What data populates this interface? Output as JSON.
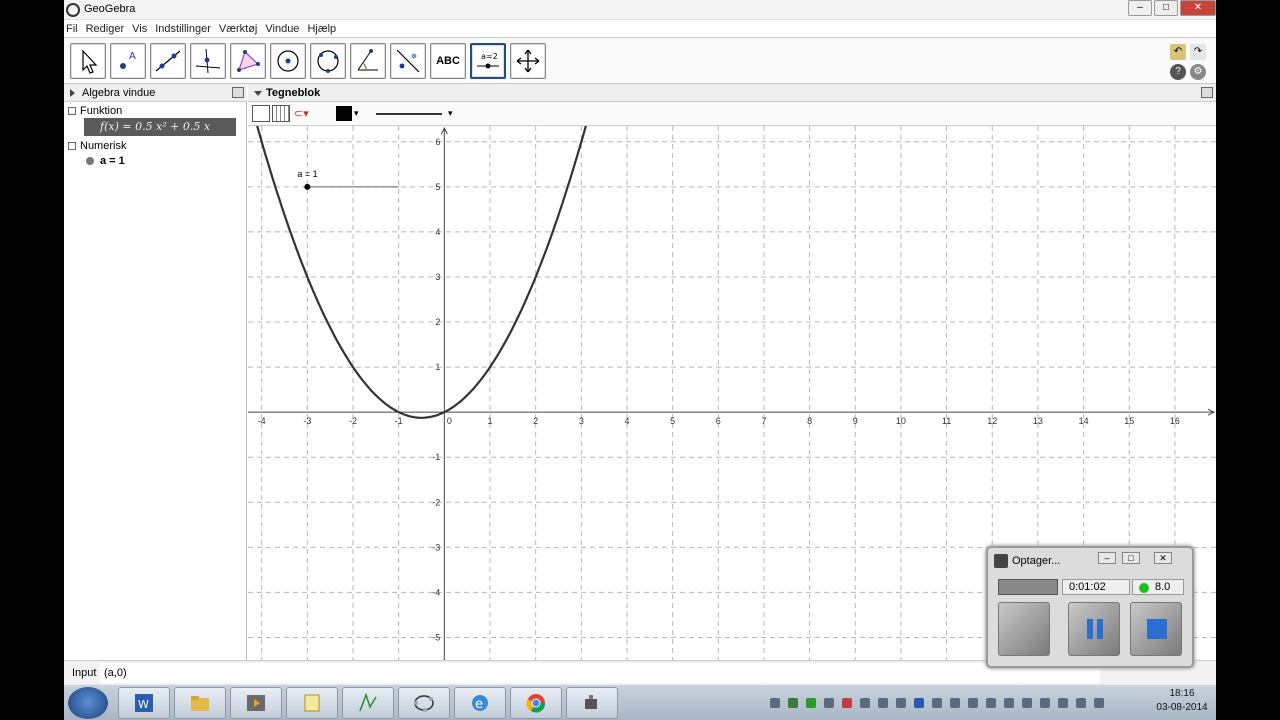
{
  "window": {
    "title": "GeoGebra"
  },
  "menu": [
    "Fil",
    "Rediger",
    "Vis",
    "Indstillinger",
    "Værktøj",
    "Vindue",
    "Hjælp"
  ],
  "toolbar": {
    "text_tool_label": "ABC",
    "slider_tool_label": "a=2"
  },
  "algebra": {
    "title": "Algebra vindue",
    "functions_label": "Funktion",
    "function_text": "f(x) = 0.5 x² + 0.5 x",
    "numeric_label": "Numerisk",
    "numeric_item": "a = 1"
  },
  "graphics": {
    "title": "Tegneblok",
    "slider_label": "a = 1"
  },
  "chart_data": {
    "type": "line",
    "x_ticks": [
      "-4",
      "-3",
      "-2",
      "-1",
      "0",
      "1",
      "2",
      "3",
      "4",
      "5",
      "6",
      "7",
      "8",
      "9",
      "10",
      "11",
      "12",
      "13",
      "14",
      "15",
      "16"
    ],
    "y_ticks": [
      "-5",
      "-4",
      "-3",
      "-2",
      "-1",
      "1",
      "2",
      "3",
      "4",
      "5",
      "6"
    ],
    "xlim": [
      -4.3,
      16.9
    ],
    "ylim": [
      -5.5,
      6.35
    ],
    "grid": true,
    "series": [
      {
        "function": "0.5*x^2+0.5*x",
        "color": "#333333"
      }
    ],
    "slider": {
      "value": 1,
      "point": [
        -3,
        5
      ],
      "line_to_x": -1
    }
  },
  "input": {
    "label": "Input",
    "value": "(a,0)"
  },
  "recorder": {
    "title": "Optager...",
    "time": "0:01:02",
    "fps": "8.0"
  },
  "clock": {
    "time": "18:16",
    "date": "03-08-2014"
  }
}
